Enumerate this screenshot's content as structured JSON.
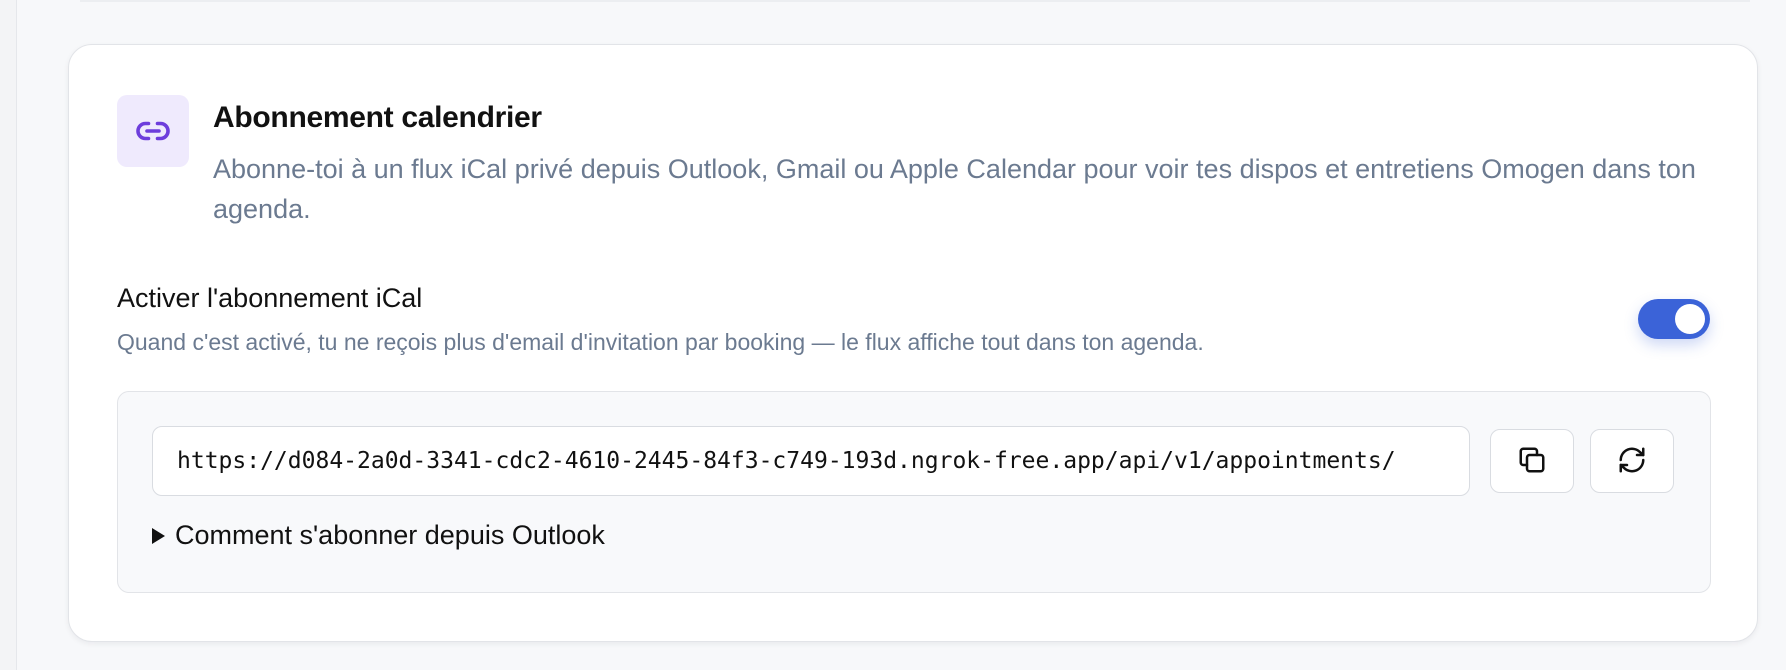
{
  "card": {
    "icon": "link-icon",
    "title": "Abonnement calendrier",
    "description": "Abonne-toi à un flux iCal privé depuis Outlook, Gmail ou Apple Calendar pour voir tes dispos et entretiens Omogen dans ton agenda."
  },
  "ical_setting": {
    "label": "Activer l'abonnement iCal",
    "help": "Quand c'est activé, tu ne reçois plus d'email d'invitation par booking — le flux affiche tout dans ton agenda.",
    "enabled": true
  },
  "feed": {
    "url": "https://d084-2a0d-3341-cdc2-4610-2445-84f3-c749-193d.ngrok-free.app/api/v1/appointments/",
    "copy_icon": "copy-icon",
    "refresh_icon": "refresh-icon",
    "outlook_help_label": "Comment s'abonner depuis Outlook"
  },
  "colors": {
    "accent": "#3b63d8",
    "icon_purple": "#6d3ddc",
    "icon_tile_bg": "#efeafd",
    "muted_text": "#6b7a90"
  }
}
